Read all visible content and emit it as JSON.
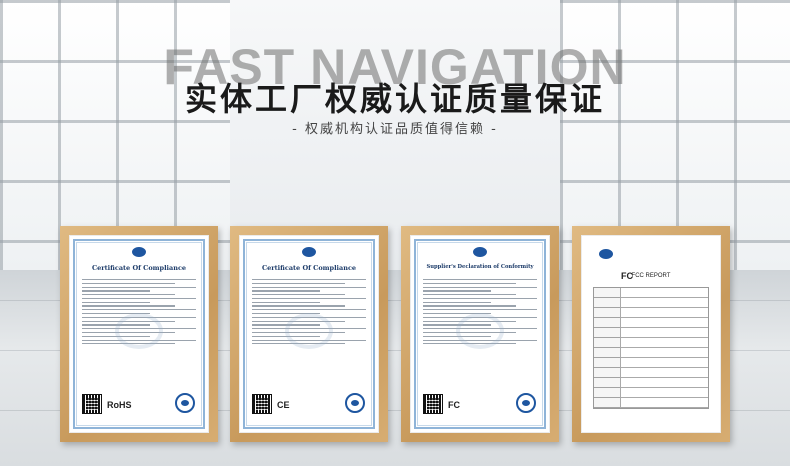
{
  "header": {
    "watermark": "FAST NAVIGATION",
    "title": "实体工厂权威认证质量保证",
    "subtitle": "- 权威机构认证品质值得信赖 -"
  },
  "certificates": [
    {
      "title": "Certificate Of Compliance",
      "mark": "RoHS"
    },
    {
      "title": "Certificate Of Compliance",
      "mark": "CE"
    },
    {
      "title": "Supplier's Declaration of Conformity",
      "mark": "FC"
    },
    {
      "title": "FCC REPORT",
      "mark": "FC"
    }
  ]
}
